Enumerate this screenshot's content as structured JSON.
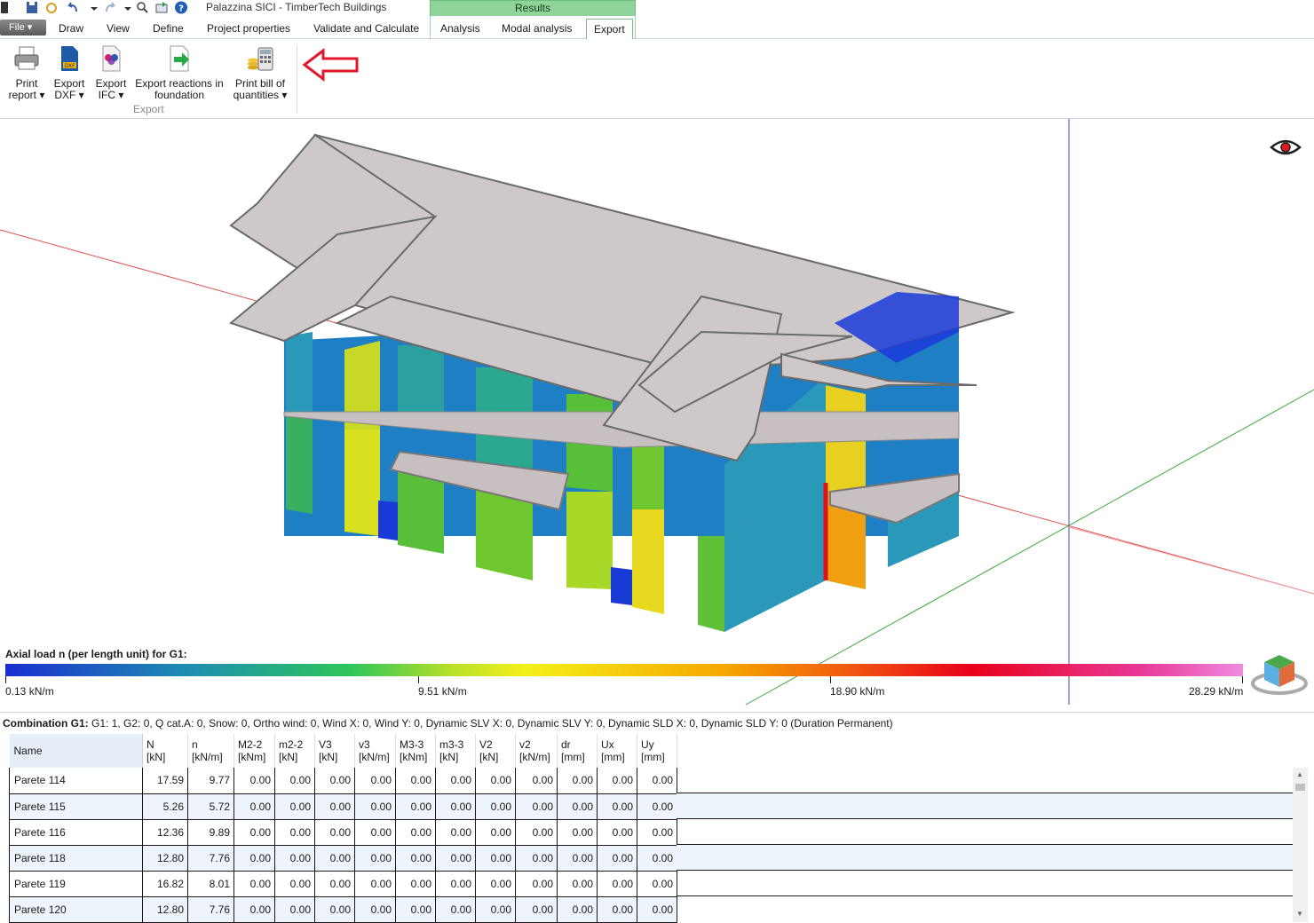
{
  "window": {
    "title": "Palazzina SICI - TimberTech Buildings",
    "context_tab": "Results"
  },
  "tabs": {
    "file": "File",
    "items": [
      "Draw",
      "View",
      "Define",
      "Project properties",
      "Validate and Calculate",
      "Analysis",
      "Modal analysis",
      "Export"
    ],
    "active": "Export"
  },
  "ribbon": {
    "print_report": [
      "Print",
      "report ▾"
    ],
    "export_dxf": [
      "Export",
      "DXF ▾"
    ],
    "export_ifc": [
      "Export",
      "IFC ▾"
    ],
    "export_reactions": [
      "Export reactions in",
      "foundation"
    ],
    "print_bill": [
      "Print bill of",
      "quantities ▾"
    ],
    "group_label": "Export"
  },
  "viewport": {
    "legend_title": "Axial load n (per length unit) for G1:",
    "scale_labels": [
      "0.13 kN/m",
      "9.51 kN/m",
      "18.90 kN/m",
      "28.29 kN/m"
    ],
    "colors": {
      "bar_start": "#1a2fcf",
      "bar_mid": "#f4f01a",
      "bar_high": "#e8001a",
      "bar_end": "#f08ae0"
    }
  },
  "results": {
    "combination_label": "Combination G1:",
    "combination_text": "G1: 1, G2: 0, Q cat.A: 0, Snow: 0, Ortho wind: 0, Wind X: 0, Wind Y: 0, Dynamic SLV X: 0, Dynamic SLV Y: 0, Dynamic SLD X: 0, Dynamic SLD Y: 0 (Duration Permanent)",
    "columns": [
      {
        "name": "Name",
        "unit": ""
      },
      {
        "name": "N",
        "unit": "[kN]"
      },
      {
        "name": "n",
        "unit": "[kN/m]"
      },
      {
        "name": "M2-2",
        "unit": "[kNm]"
      },
      {
        "name": "m2-2",
        "unit": "[kN]"
      },
      {
        "name": "V3",
        "unit": "[kN]"
      },
      {
        "name": "v3",
        "unit": "[kN/m]"
      },
      {
        "name": "M3-3",
        "unit": "[kNm]"
      },
      {
        "name": "m3-3",
        "unit": "[kN]"
      },
      {
        "name": "V2",
        "unit": "[kN]"
      },
      {
        "name": "v2",
        "unit": "[kN/m]"
      },
      {
        "name": "dr",
        "unit": "[mm]"
      },
      {
        "name": "Ux",
        "unit": "[mm]"
      },
      {
        "name": "Uy",
        "unit": "[mm]"
      }
    ],
    "rows": [
      [
        "Parete 114",
        "17.59",
        "9.77",
        "0.00",
        "0.00",
        "0.00",
        "0.00",
        "0.00",
        "0.00",
        "0.00",
        "0.00",
        "0.00",
        "0.00",
        "0.00"
      ],
      [
        "Parete 115",
        "5.26",
        "5.72",
        "0.00",
        "0.00",
        "0.00",
        "0.00",
        "0.00",
        "0.00",
        "0.00",
        "0.00",
        "0.00",
        "0.00",
        "0.00"
      ],
      [
        "Parete 116",
        "12.36",
        "9.89",
        "0.00",
        "0.00",
        "0.00",
        "0.00",
        "0.00",
        "0.00",
        "0.00",
        "0.00",
        "0.00",
        "0.00",
        "0.00"
      ],
      [
        "Parete 118",
        "12.80",
        "7.76",
        "0.00",
        "0.00",
        "0.00",
        "0.00",
        "0.00",
        "0.00",
        "0.00",
        "0.00",
        "0.00",
        "0.00",
        "0.00"
      ],
      [
        "Parete 119",
        "16.82",
        "8.01",
        "0.00",
        "0.00",
        "0.00",
        "0.00",
        "0.00",
        "0.00",
        "0.00",
        "0.00",
        "0.00",
        "0.00",
        "0.00"
      ],
      [
        "Parete 120",
        "12.80",
        "7.76",
        "0.00",
        "0.00",
        "0.00",
        "0.00",
        "0.00",
        "0.00",
        "0.00",
        "0.00",
        "0.00",
        "0.00",
        "0.00"
      ]
    ]
  }
}
